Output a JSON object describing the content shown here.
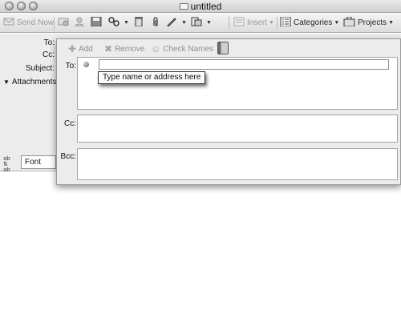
{
  "window": {
    "title": "untitled"
  },
  "toolbar": {
    "send_now": "Send Now",
    "insert": "Insert",
    "categories": "Categories",
    "projects": "Projects"
  },
  "header": {
    "to_label": "To:",
    "cc_label": "Cc:",
    "subject_label": "Subject:",
    "attachments_label": "Attachments:"
  },
  "format_bar": {
    "font_value": "Font"
  },
  "address_popup": {
    "add_label": "Add",
    "remove_label": "Remove",
    "check_names_label": "Check Names",
    "to_label": "To:",
    "cc_label": "Cc:",
    "bcc_label": "Bcc:",
    "to_value": "",
    "tooltip": "Type name or address here"
  }
}
